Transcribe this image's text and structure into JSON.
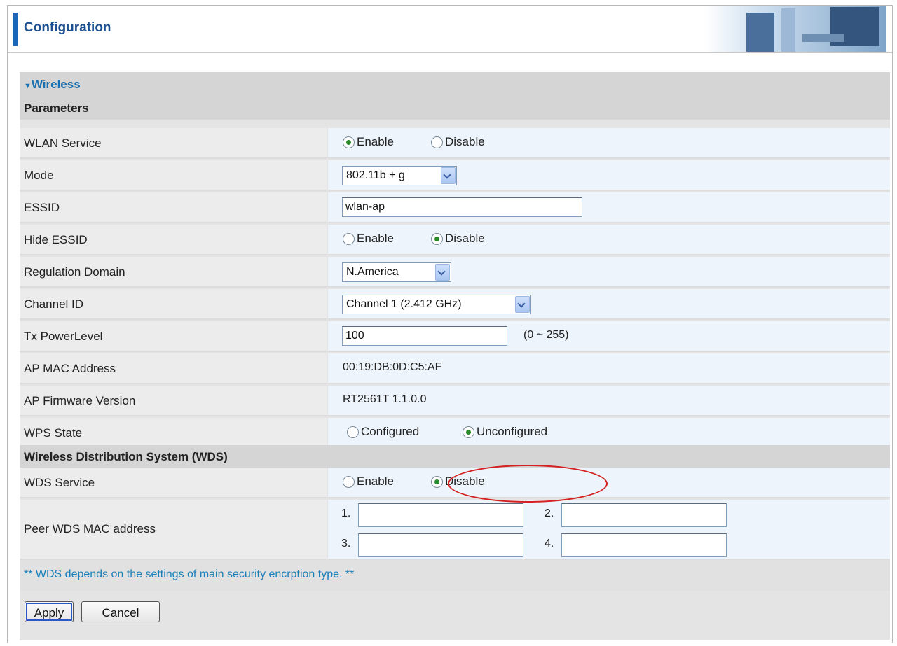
{
  "header": {
    "title": "Configuration"
  },
  "wireless": {
    "section_title": "Wireless",
    "parameters_title": "Parameters",
    "wlan_service": {
      "label": "WLAN Service",
      "enable": "Enable",
      "disable": "Disable",
      "selected": "Enable"
    },
    "mode": {
      "label": "Mode",
      "value": "802.11b + g"
    },
    "essid": {
      "label": "ESSID",
      "value": "wlan-ap"
    },
    "hide_essid": {
      "label": "Hide ESSID",
      "enable": "Enable",
      "disable": "Disable",
      "selected": "Disable"
    },
    "regulation_domain": {
      "label": "Regulation Domain",
      "value": "N.America"
    },
    "channel_id": {
      "label": "Channel ID",
      "value": "Channel 1 (2.412 GHz)"
    },
    "tx_power": {
      "label": "Tx PowerLevel",
      "value": "100",
      "hint": "(0 ~ 255)"
    },
    "ap_mac": {
      "label": "AP MAC Address",
      "value": "00:19:DB:0D:C5:AF"
    },
    "ap_firmware": {
      "label": "AP Firmware Version",
      "value": "RT2561T 1.1.0.0"
    },
    "wps_state": {
      "label": "WPS State",
      "configured": "Configured",
      "unconfigured": "Unconfigured",
      "selected": "Unconfigured"
    }
  },
  "wds": {
    "title": "Wireless Distribution System (WDS)",
    "service": {
      "label": "WDS Service",
      "enable": "Enable",
      "disable": "Disable",
      "selected": "Disable"
    },
    "peer": {
      "label": "Peer WDS MAC address",
      "fields": [
        {
          "index": "1.",
          "value": ""
        },
        {
          "index": "2.",
          "value": ""
        },
        {
          "index": "3.",
          "value": ""
        },
        {
          "index": "4.",
          "value": ""
        }
      ]
    },
    "note": "** WDS depends on the settings of main security encrption type. **"
  },
  "buttons": {
    "apply": "Apply",
    "cancel": "Cancel"
  },
  "colors": {
    "accent": "#1a6fb0",
    "highlight_oval": "#d42020",
    "radio_selected": "#2a8a2a"
  }
}
